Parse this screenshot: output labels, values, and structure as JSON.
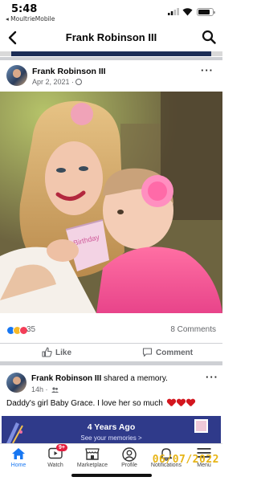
{
  "status_bar": {
    "time": "5:48",
    "back_app": "◂ MoultrieMobile"
  },
  "header": {
    "title": "Frank Robinson III"
  },
  "post1": {
    "author": "Frank Robinson III",
    "date": "Apr 2, 2021 ·",
    "reaction_count": "35",
    "comments_label": "8 Comments",
    "like_label": "Like",
    "comment_label": "Comment",
    "cup_text": "Birthday"
  },
  "post2": {
    "author": "Frank Robinson III",
    "action": " shared a memory.",
    "time": "14h ·",
    "text": "Daddy's girl Baby Grace.  I love her so much"
  },
  "memory": {
    "title": "4 Years Ago",
    "subtitle": "See your memories >"
  },
  "nav": {
    "items": [
      {
        "label": "Home",
        "icon": "home-icon"
      },
      {
        "label": "Watch",
        "icon": "watch-icon",
        "badge": "9+"
      },
      {
        "label": "Marketplace",
        "icon": "marketplace-icon"
      },
      {
        "label": "Profile",
        "icon": "profile-icon"
      },
      {
        "label": "Notifications",
        "icon": "bell-icon"
      },
      {
        "label": "Menu",
        "icon": "menu-icon"
      }
    ]
  },
  "overlay": {
    "datestamp": "06/07/2022"
  },
  "colors": {
    "accent": "#1877f2",
    "heart": "#d3161e",
    "memory_bg": "#2f3a8a",
    "datestamp": "#e7b416"
  }
}
